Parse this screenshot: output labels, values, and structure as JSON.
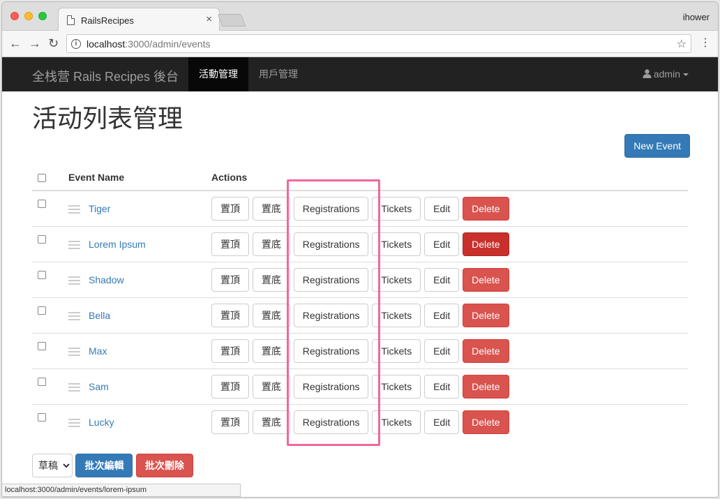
{
  "browser": {
    "tab_title": "RailsRecipes",
    "tab_close": "×",
    "profile_name": "ihower",
    "url_host": "localhost",
    "url_path": ":3000/admin/events",
    "back_glyph": "←",
    "forward_glyph": "→",
    "reload_glyph": "↻",
    "star_glyph": "☆",
    "menu_glyph": "⋮",
    "status_url": "localhost:3000/admin/events/lorem-ipsum"
  },
  "navbar": {
    "brand": "全栈营 Rails Recipes 後台",
    "items": [
      {
        "label": "活動管理",
        "active": true
      },
      {
        "label": "用戶管理",
        "active": false
      }
    ],
    "user_label": "admin"
  },
  "page": {
    "title": "活动列表管理",
    "new_event_label": "New Event"
  },
  "table": {
    "headers": {
      "name": "Event Name",
      "actions": "Actions"
    },
    "actions": {
      "top": "置頂",
      "bottom": "置底",
      "registrations": "Registrations",
      "tickets": "Tickets",
      "edit": "Edit",
      "delete": "Delete"
    },
    "rows": [
      {
        "name": "Tiger"
      },
      {
        "name": "Lorem Ipsum"
      },
      {
        "name": "Shadow"
      },
      {
        "name": "Bella"
      },
      {
        "name": "Max"
      },
      {
        "name": "Sam"
      },
      {
        "name": "Lucky"
      }
    ]
  },
  "bulk": {
    "status_selected": "草稿",
    "bulk_edit_label": "批次編輯",
    "bulk_delete_label": "批次刪除"
  },
  "colors": {
    "primary": "#337ab7",
    "danger": "#d9534f",
    "danger_hover": "#c9302c",
    "navbar": "#222222",
    "highlight": "#f0679e"
  }
}
